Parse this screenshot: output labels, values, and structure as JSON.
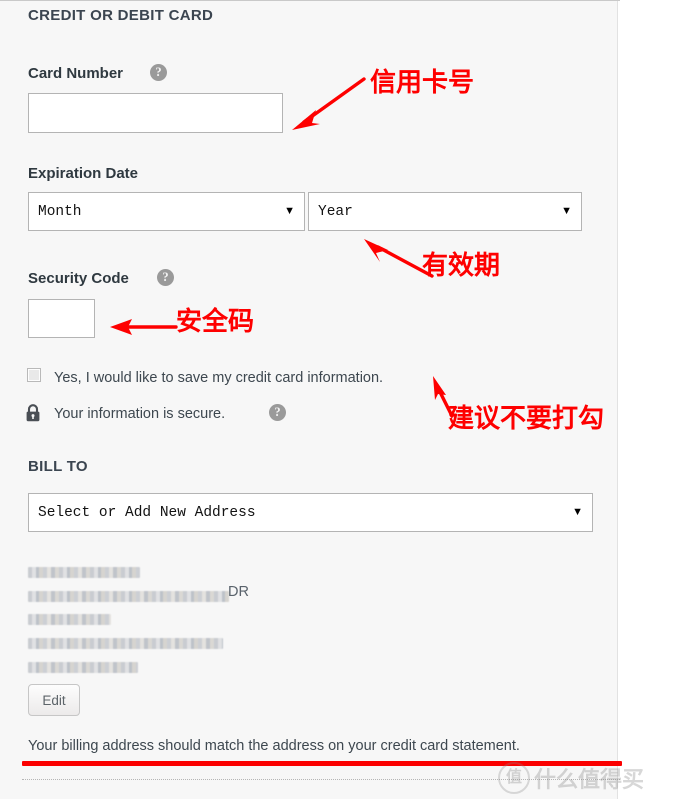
{
  "panel": {
    "section_card_title": "CREDIT OR DEBIT CARD",
    "section_bill_title": "BILL TO"
  },
  "card_number": {
    "label": "Card Number",
    "help_icon": "question-mark-icon",
    "value": "",
    "placeholder": ""
  },
  "expiration": {
    "label": "Expiration Date",
    "month_value": "Month",
    "year_value": "Year",
    "caret": "▼"
  },
  "security_code": {
    "label": "Security Code",
    "help_icon": "question-mark-icon",
    "value": "",
    "placeholder": ""
  },
  "save_card": {
    "label": "Yes, I would like to save my credit card information.",
    "checked": false
  },
  "secure_notice": {
    "label": "Your information is secure.",
    "lock_icon": "lock-icon",
    "help_icon": "question-mark-icon"
  },
  "bill_to": {
    "address_select_value": "Select or Add New Address",
    "caret": "▼",
    "address_lines": [
      "",
      "",
      "",
      "",
      ""
    ],
    "address_line2_tail": "DR",
    "edit_button": "Edit",
    "note": "Your billing address should match the address on your credit card statement."
  },
  "annotations": {
    "card_number_note": "信用卡号",
    "expiration_note": "有效期",
    "security_code_note": "安全码",
    "checkbox_note": "建议不要打勾",
    "color": "#FE0000"
  },
  "watermark": {
    "badge": "值",
    "text": "什么值得买"
  }
}
